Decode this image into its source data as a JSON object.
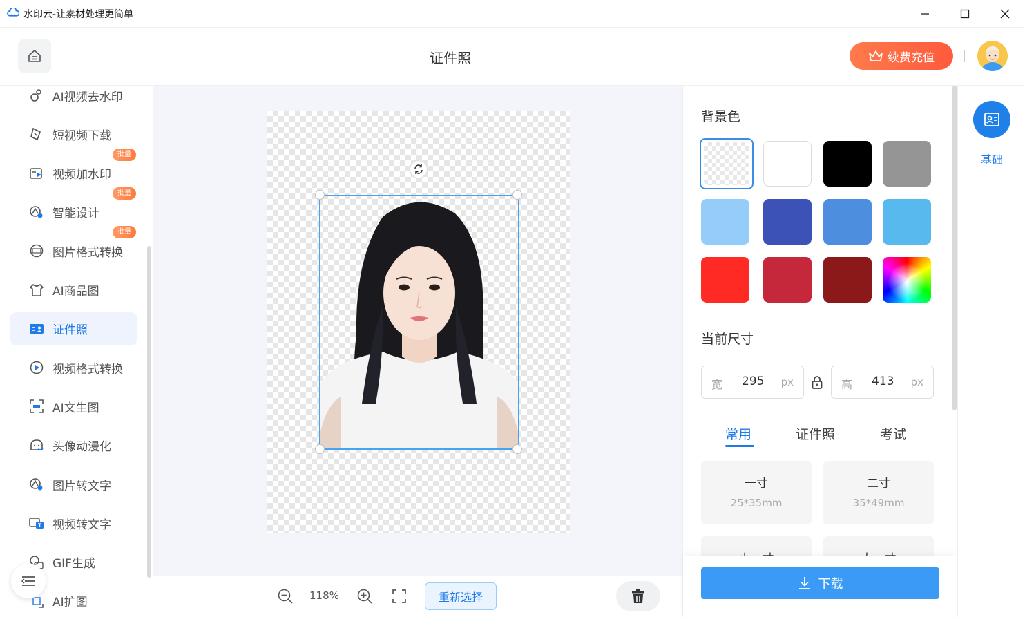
{
  "window": {
    "title": "水印云-让素材处理更简单",
    "minimize": "—",
    "maximize": "☐",
    "close": "✕"
  },
  "header": {
    "page_title": "证件照",
    "vip_label": "续费充值"
  },
  "sidebar": {
    "items": [
      {
        "label": "AI视频去水印",
        "icon": "video-watermark-remove-icon"
      },
      {
        "label": "短视频下载",
        "icon": "short-video-download-icon"
      },
      {
        "label": "视频加水印",
        "icon": "video-add-watermark-icon",
        "badge": "批量"
      },
      {
        "label": "智能设计",
        "icon": "smart-design-icon",
        "badge": "批量"
      },
      {
        "label": "图片格式转换",
        "icon": "image-format-convert-icon",
        "badge": "批量"
      },
      {
        "label": "AI商品图",
        "icon": "ai-product-image-icon"
      },
      {
        "label": "证件照",
        "icon": "id-photo-icon",
        "active": true
      },
      {
        "label": "视频格式转换",
        "icon": "video-format-convert-icon"
      },
      {
        "label": "AI文生图",
        "icon": "ai-text-to-image-icon"
      },
      {
        "label": "头像动漫化",
        "icon": "avatar-anime-icon"
      },
      {
        "label": "图片转文字",
        "icon": "image-to-text-icon"
      },
      {
        "label": "视频转文字",
        "icon": "video-to-text-icon"
      },
      {
        "label": "GIF生成",
        "icon": "gif-generate-icon"
      },
      {
        "label": "AI扩图",
        "icon": "ai-expand-image-icon"
      }
    ]
  },
  "toolbar": {
    "zoom": "118%",
    "reselect_label": "重新选择"
  },
  "panel": {
    "bg_title": "背景色",
    "colors": [
      "transparent",
      "#ffffff",
      "#000000",
      "#959595",
      "#94cdf9",
      "#3d52b6",
      "#4d8fde",
      "#57b9ee",
      "#ff2a24",
      "#c4283a",
      "#8b191a",
      "rainbow"
    ],
    "size_title": "当前尺寸",
    "width_label": "宽",
    "width_value": "295",
    "height_label": "高",
    "height_value": "413",
    "unit": "px",
    "tabs": [
      "常用",
      "证件照",
      "考试"
    ],
    "presets": [
      {
        "name": "一寸",
        "size": "25*35mm"
      },
      {
        "name": "二寸",
        "size": "35*49mm"
      },
      {
        "name": "小一寸",
        "size": ""
      },
      {
        "name": "大一寸",
        "size": ""
      }
    ],
    "download_label": "下载"
  },
  "rail": {
    "label": "基础"
  }
}
